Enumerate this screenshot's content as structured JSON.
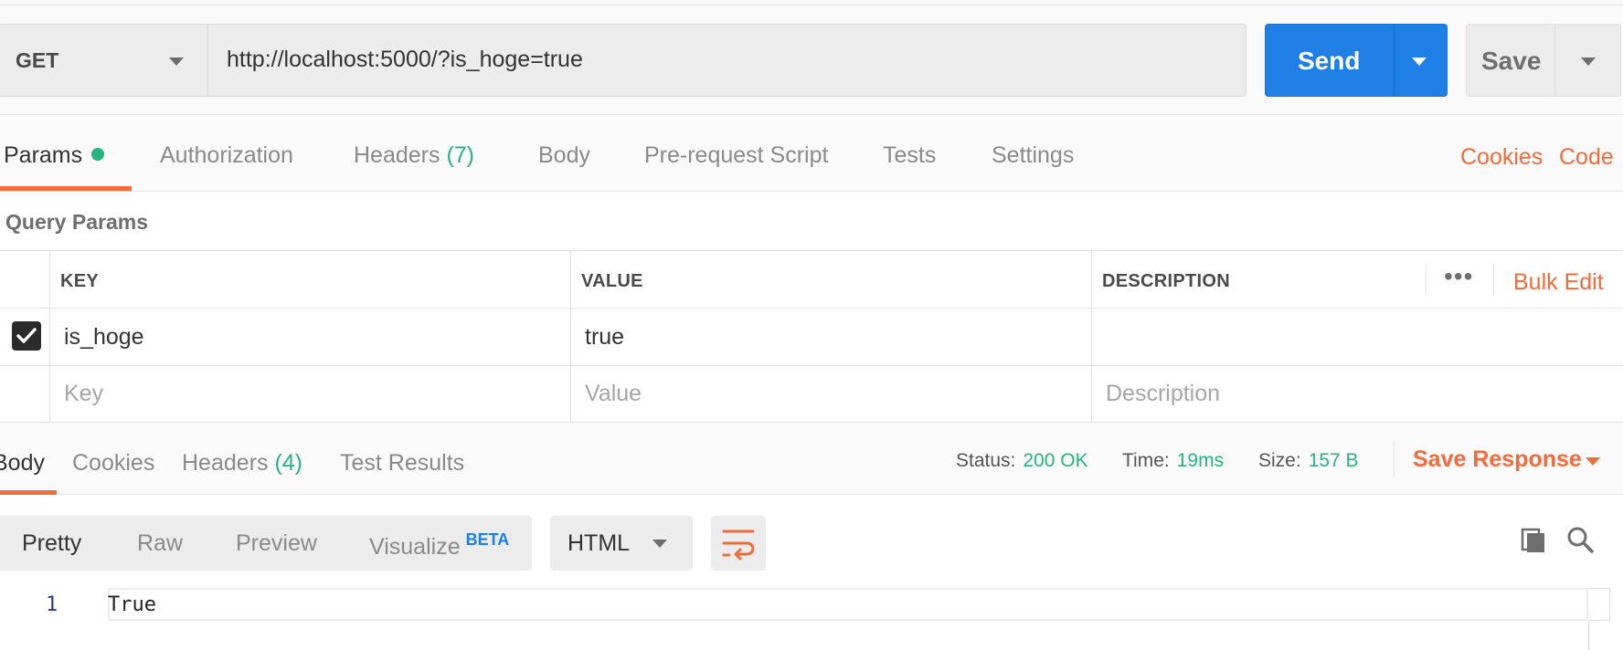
{
  "request": {
    "method": "GET",
    "url": "http://localhost:5000/?is_hoge=true",
    "send_label": "Send",
    "save_label": "Save"
  },
  "request_tabs": {
    "params": "Params",
    "authorization": "Authorization",
    "headers": "Headers",
    "headers_count": "(7)",
    "body": "Body",
    "prerequest": "Pre-request Script",
    "tests": "Tests",
    "settings": "Settings"
  },
  "links": {
    "cookies": "Cookies",
    "code": "Code"
  },
  "query_params": {
    "title": "Query Params",
    "columns": {
      "key": "KEY",
      "value": "VALUE",
      "description": "DESCRIPTION"
    },
    "more": "•••",
    "bulk_edit": "Bulk Edit",
    "rows": [
      {
        "enabled": true,
        "key": "is_hoge",
        "value": "true",
        "description": ""
      }
    ],
    "placeholders": {
      "key": "Key",
      "value": "Value",
      "description": "Description"
    }
  },
  "response_tabs": {
    "body": "Body",
    "cookies": "Cookies",
    "headers": "Headers",
    "headers_count": "(4)",
    "test_results": "Test Results"
  },
  "response_status": {
    "status_label": "Status:",
    "status_value": "200 OK",
    "time_label": "Time:",
    "time_value": "19ms",
    "size_label": "Size:",
    "size_value": "157 B",
    "save_response": "Save Response"
  },
  "format": {
    "pretty": "Pretty",
    "raw": "Raw",
    "preview": "Preview",
    "visualize": "Visualize",
    "beta": "BETA",
    "language": "HTML"
  },
  "editor": {
    "line_number": "1",
    "content": "True"
  },
  "colors": {
    "accent": "#f26b3a",
    "primary": "#1f7fe5",
    "success": "#26b47f"
  }
}
